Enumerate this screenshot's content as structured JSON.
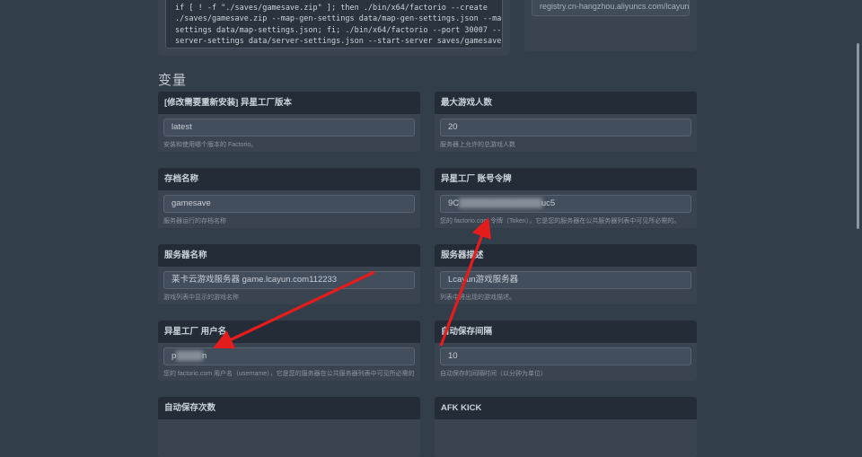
{
  "top": {
    "startup_command_lines": [
      "if [ ! -f \"./saves/gamesave.zip\" ]; then ./bin/x64/factorio --create",
      "./saves/gamesave.zip --map-gen-settings data/map-gen-settings.json --map-",
      "settings data/map-settings.json; fi; ./bin/x64/factorio --port 30007 --",
      "server-settings data/server-settings.json --start-server saves/gamesave.zip"
    ],
    "docker_image": "registry.cn-hangzhou.aliyuncs.com/lcayun/yolks:deb"
  },
  "section": {
    "title": "变量"
  },
  "fields": [
    {
      "label": "[修改需要重新安装] 异星工厂版本",
      "value": "latest",
      "help": "安装和使用哪个版本的 Factorio。"
    },
    {
      "label": "最大游戏人数",
      "value": "20",
      "help": "服务器上允许的总游戏人数"
    },
    {
      "label": "存档名称",
      "value": "gamesave",
      "help": "服务器运行的存档名称"
    },
    {
      "label": "异星工厂 账号令牌",
      "value_pre": "9C",
      "value_blur": "████████████████",
      "value_post": "uc5",
      "help": "您的 factorio.com 令牌（Token），它是您的服务器在公共服务器列表中可见所必需的。"
    },
    {
      "label": "服务器名称",
      "value": "莱卡云游戏服务器 game.lcayun.com112233",
      "help": "游戏列表中显示的游戏名称"
    },
    {
      "label": "服务器描述",
      "value": "Lcayun游戏服务器",
      "help": "列表中将出现的游戏描述。"
    },
    {
      "label": "异星工厂 用户名",
      "value_pre": "p",
      "value_blur": "█████",
      "value_post": "n",
      "help": "您的 factorio.com 用户名（username），它是您的服务器在公共服务器列表中可见所必需的。"
    },
    {
      "label": "自动保存间隔",
      "value": "10",
      "help": "自动保存的间隔时间（以分钟为单位）"
    },
    {
      "label": "自动保存次数"
    },
    {
      "label": "AFK KICK"
    }
  ],
  "annotation": {
    "color": "#e51c1c"
  }
}
